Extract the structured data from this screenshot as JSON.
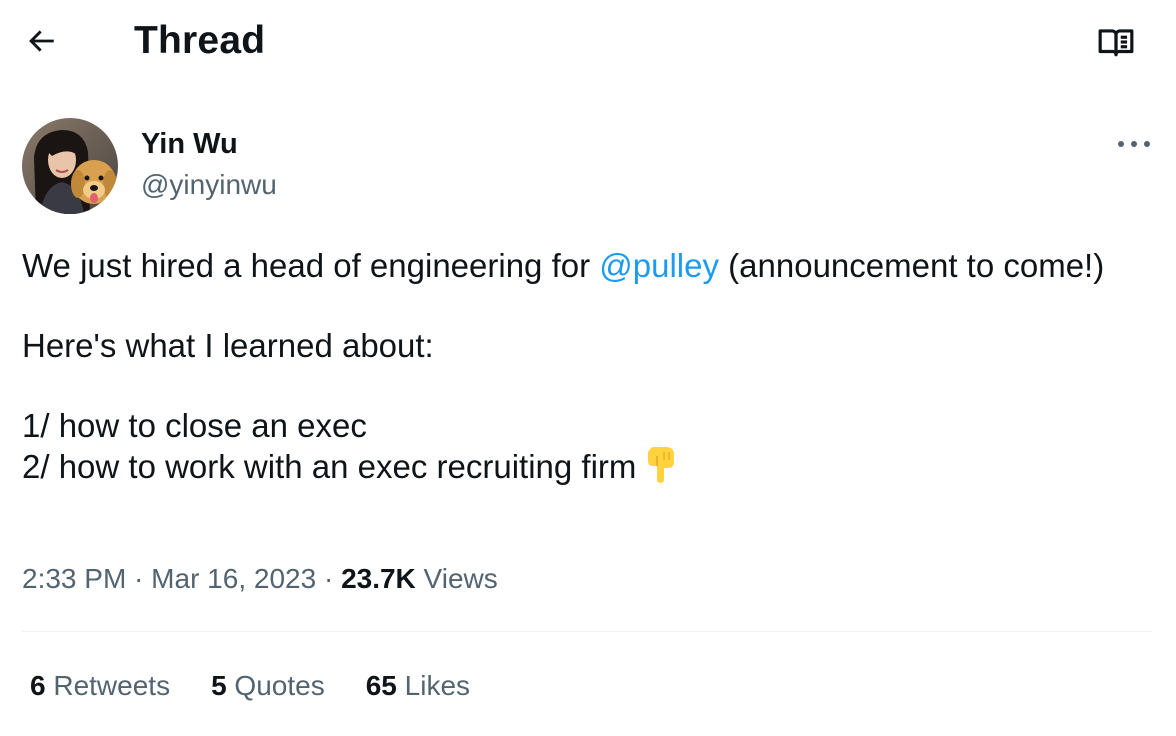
{
  "header": {
    "title": "Thread",
    "back_icon": "arrow-left-icon",
    "reader_icon": "book-open-icon"
  },
  "author": {
    "display_name": "Yin Wu",
    "handle": "@yinyinwu",
    "more_icon": "more-horizontal-icon"
  },
  "tweet": {
    "line1_before": "We just hired a head of engineering for ",
    "mention": "@pulley",
    "line1_after": " (announcement to come!)",
    "line2": "Here's what I learned about:",
    "line3": "1/ how to close an exec",
    "line4": "2/ how to work with an exec recruiting firm",
    "emoji_icon": "backhand-index-pointing-down-icon"
  },
  "meta": {
    "time": "2:33 PM",
    "sep1": " · ",
    "date": "Mar 16, 2023",
    "sep2": " · ",
    "views_count": "23.7K",
    "views_label": " Views"
  },
  "stats": {
    "retweets_count": "6",
    "retweets_label": " Retweets",
    "quotes_count": "5",
    "quotes_label": " Quotes",
    "likes_count": "65",
    "likes_label": " Likes"
  },
  "colors": {
    "text": "#0f1419",
    "secondary": "#536471",
    "accent": "#1d9bf0",
    "divider": "#eff3f4"
  }
}
